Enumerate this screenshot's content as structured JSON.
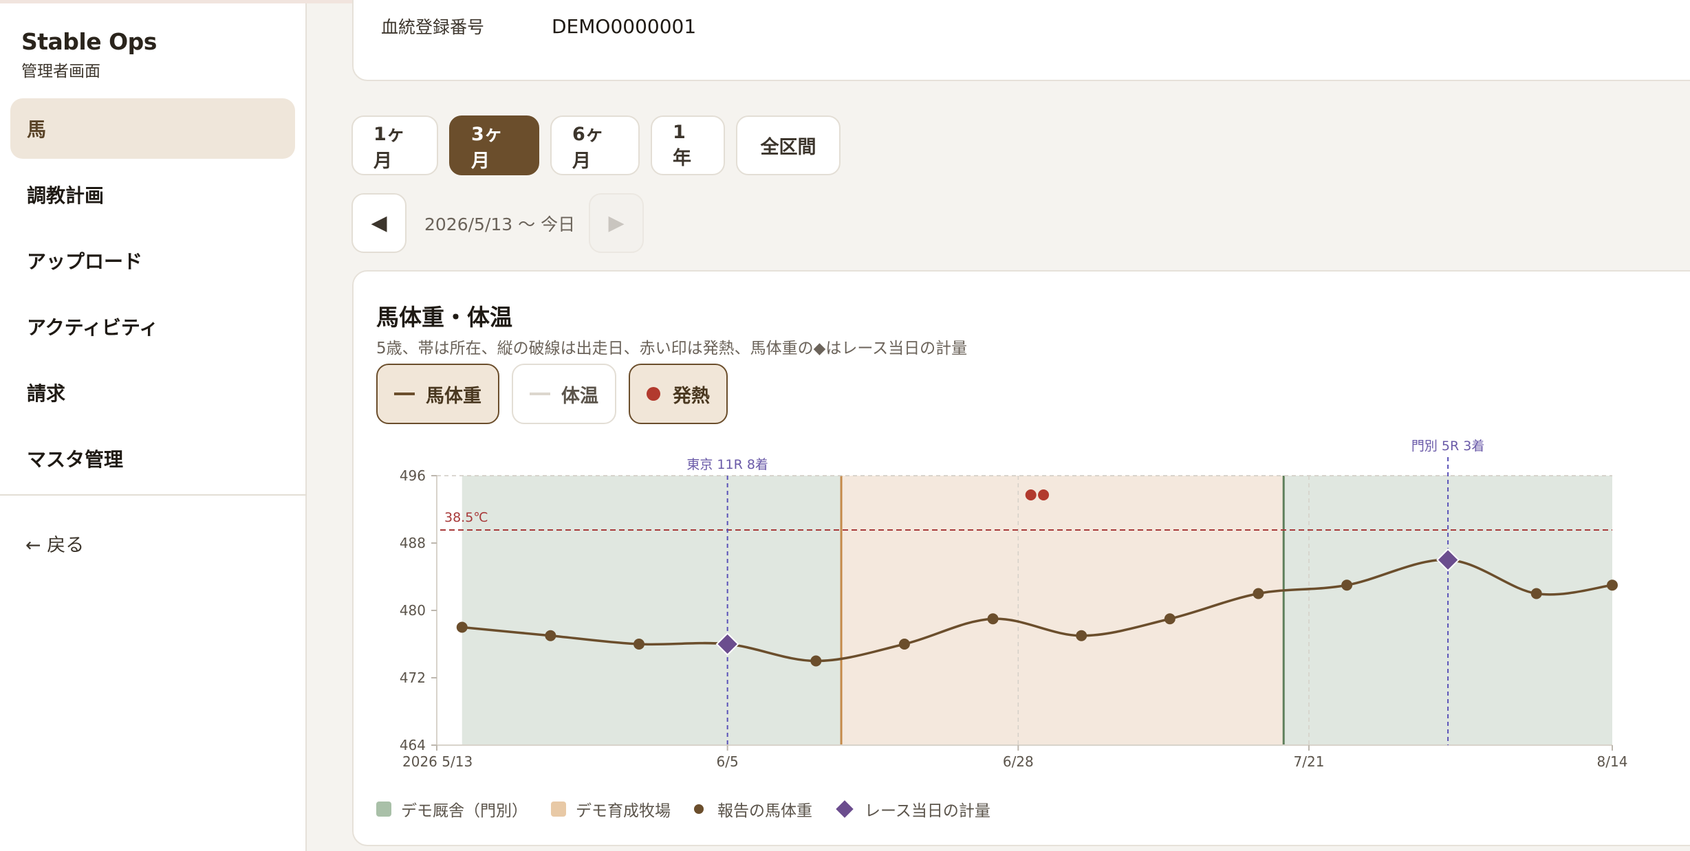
{
  "sidebar": {
    "brand_title": "Stable Ops",
    "brand_subtitle": "管理者画面",
    "items": [
      {
        "label": "馬",
        "active": true
      },
      {
        "label": "調教計画"
      },
      {
        "label": "アップロード"
      },
      {
        "label": "アクティビティ"
      },
      {
        "label": "請求"
      },
      {
        "label": "マスタ管理"
      }
    ],
    "back_label": "← 戻る"
  },
  "info": {
    "label": "血統登録番号",
    "value": "DEMO0000001"
  },
  "ranges": [
    {
      "label": "1ヶ月"
    },
    {
      "label": "3ヶ月",
      "active": true
    },
    {
      "label": "6ヶ月"
    },
    {
      "label": "1年"
    },
    {
      "label": "全区間"
    }
  ],
  "period": {
    "prev_icon": "◀",
    "next_icon": "▶",
    "text": "2026/5/13 〜 今日"
  },
  "chart_card": {
    "title": "馬体重・体温",
    "subtitle": "5歳、帯は所在、縦の破線は出走日、赤い印は発熱、馬体重の◆はレース当日の計量",
    "toggles": [
      {
        "label": "馬体重",
        "on": true
      },
      {
        "label": "体温",
        "on": false
      },
      {
        "label": "発熱",
        "on": true
      }
    ],
    "legend": [
      {
        "label": "デモ厩舎（門別）",
        "color": "#a9c0a8"
      },
      {
        "label": "デモ育成牧場",
        "color": "#e8c9a6"
      },
      {
        "label": "報告の馬体重"
      },
      {
        "label": "レース当日の計量"
      }
    ]
  },
  "chart_data": {
    "type": "line",
    "x_start": "2026-05-13",
    "x_end": "2026-08-14",
    "x_tick_labels": [
      {
        "date": "2026-05-13",
        "label": "2026 5/13"
      },
      {
        "date": "2026-06-05",
        "label": "6/5"
      },
      {
        "date": "2026-06-28",
        "label": "6/28"
      },
      {
        "date": "2026-07-21",
        "label": "7/21"
      },
      {
        "date": "2026-08-14",
        "label": "8/14"
      }
    ],
    "ylim": [
      464,
      496
    ],
    "y_ticks": [
      464,
      472,
      480,
      488,
      496
    ],
    "threshold": {
      "label": "38.5℃",
      "color": "#a83a3a"
    },
    "bands": [
      {
        "name": "デモ厩舎（門別）",
        "from": "2026-05-15",
        "to": "2026-06-14",
        "color": "#e0e7e0"
      },
      {
        "name": "デモ育成牧場",
        "from": "2026-06-14",
        "to": "2026-07-19",
        "color": "#f4e8dd",
        "start_line_color": "#c48a4a"
      },
      {
        "name": "デモ厩舎（門別）",
        "from": "2026-07-19",
        "to": "2026-08-14",
        "color": "#e0e7e0",
        "start_line_color": "#5e7f5a"
      }
    ],
    "races": [
      {
        "date": "2026-06-05",
        "label": "東京 11R 8着"
      },
      {
        "date": "2026-08-01",
        "label": "門別 5R 3着"
      }
    ],
    "fever_dates": [
      "2026-06-29",
      "2026-06-30"
    ],
    "series": [
      {
        "name": "報告の馬体重",
        "color": "#6b4e2c",
        "points": [
          {
            "date": "2026-05-15",
            "value": 478
          },
          {
            "date": "2026-05-22",
            "value": 477
          },
          {
            "date": "2026-05-29",
            "value": 476
          },
          {
            "date": "2026-06-05",
            "value": 476,
            "race_day": true
          },
          {
            "date": "2026-06-12",
            "value": 474
          },
          {
            "date": "2026-06-19",
            "value": 476
          },
          {
            "date": "2026-06-26",
            "value": 479
          },
          {
            "date": "2026-07-03",
            "value": 477
          },
          {
            "date": "2026-07-10",
            "value": 479
          },
          {
            "date": "2026-07-17",
            "value": 482
          },
          {
            "date": "2026-07-24",
            "value": 483
          },
          {
            "date": "2026-08-01",
            "value": 486,
            "race_day": true
          },
          {
            "date": "2026-08-08",
            "value": 482
          },
          {
            "date": "2026-08-14",
            "value": 483
          }
        ]
      }
    ]
  }
}
